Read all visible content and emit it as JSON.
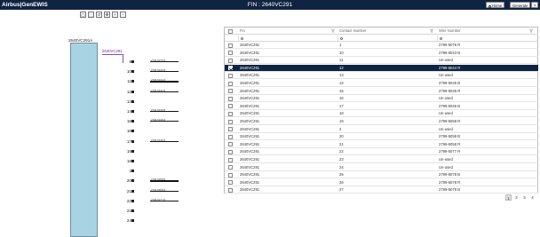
{
  "app": {
    "brand": "Airbus|GenEWIS",
    "title": "FIN : 2640VC291"
  },
  "header_buttons": {
    "home": "Home",
    "generate": "Generate",
    "help": "?"
  },
  "toolbar": {
    "tools": [
      "fit-icon",
      "select-icon",
      "reset-icon",
      "pan-icon",
      "zoom-in-icon",
      "zoom-out-icon"
    ]
  },
  "diagram": {
    "connector_label": "2640VC291A",
    "sub_label": "2640VC291",
    "pins": [
      {
        "num": "9",
        "wire": "2799-5076 R"
      },
      {
        "num": "10",
        "wire": "2799-5043 B"
      },
      {
        "num": "11",
        "wire": "2799-5044 R"
      },
      {
        "num": "12",
        "wire": "2799-5044 R"
      },
      {
        "num": "13",
        "wire": ""
      },
      {
        "num": "14",
        "wire": "2799-5045 B"
      },
      {
        "num": "15",
        "wire": "2799-5045 R"
      },
      {
        "num": "16",
        "wire": ""
      },
      {
        "num": "17",
        "wire": "2799-5046 R"
      },
      {
        "num": "18",
        "wire": ""
      },
      {
        "num": "19",
        "wire": ""
      },
      {
        "num": "2",
        "wire": ""
      },
      {
        "num": "20",
        "wire": "2799-5058 B"
      },
      {
        "num": "21",
        "wire": "2799-5058 R"
      },
      {
        "num": "22",
        "wire": "2799-5077 R"
      },
      {
        "num": "23",
        "wire": ""
      },
      {
        "num": "24",
        "wire": ""
      }
    ]
  },
  "grid": {
    "headers": {
      "fin": "Fin",
      "contact": "Contact Number",
      "wire": "Wire Number"
    },
    "rows": [
      {
        "fin": "2640VC291",
        "contact": "1",
        "wire": "2799-5076 R",
        "selected": false
      },
      {
        "fin": "2640VC291",
        "contact": "10",
        "wire": "2799-5043 B",
        "selected": false
      },
      {
        "fin": "2640VC291",
        "contact": "11",
        "wire": "Un-used",
        "selected": false
      },
      {
        "fin": "2640VC291",
        "contact": "12",
        "wire": "2799-5044 R",
        "selected": true
      },
      {
        "fin": "2640VC291",
        "contact": "13",
        "wire": "Un-used",
        "selected": false
      },
      {
        "fin": "2640VC291",
        "contact": "14",
        "wire": "2799-5045 B",
        "selected": false
      },
      {
        "fin": "2640VC291",
        "contact": "15",
        "wire": "2799-5045 R",
        "selected": false
      },
      {
        "fin": "2640VC291",
        "contact": "16",
        "wire": "Un-used",
        "selected": false
      },
      {
        "fin": "2640VC291",
        "contact": "17",
        "wire": "2799-5046 B",
        "selected": false
      },
      {
        "fin": "2640VC291",
        "contact": "18",
        "wire": "Un-used",
        "selected": false
      },
      {
        "fin": "2640VC291",
        "contact": "19",
        "wire": "2799-5058 R",
        "selected": false
      },
      {
        "fin": "2640VC291",
        "contact": "2",
        "wire": "Un-used",
        "selected": false
      },
      {
        "fin": "2640VC291",
        "contact": "20",
        "wire": "2799-5058 B",
        "selected": false
      },
      {
        "fin": "2640VC291",
        "contact": "21",
        "wire": "2799-5058 R",
        "selected": false
      },
      {
        "fin": "2640VC291",
        "contact": "22",
        "wire": "2799-5077 R",
        "selected": false
      },
      {
        "fin": "2640VC291",
        "contact": "23",
        "wire": "Un-used",
        "selected": false
      },
      {
        "fin": "2640VC291",
        "contact": "24",
        "wire": "Un-used",
        "selected": false
      },
      {
        "fin": "2640VC291",
        "contact": "25",
        "wire": "2799-5078 B",
        "selected": false
      },
      {
        "fin": "2640VC291",
        "contact": "26",
        "wire": "2799-5078 R",
        "selected": false
      },
      {
        "fin": "2640VC291",
        "contact": "27",
        "wire": "2799-5079 B",
        "selected": false
      }
    ]
  },
  "pager": {
    "pages": [
      "1",
      "2",
      "3",
      "4"
    ],
    "current": "1"
  },
  "colors": {
    "topbar": "#0f2443",
    "connector": "#a8d3e3",
    "selected_row": "#0f2443",
    "wire_label": "#8b4fa8"
  }
}
